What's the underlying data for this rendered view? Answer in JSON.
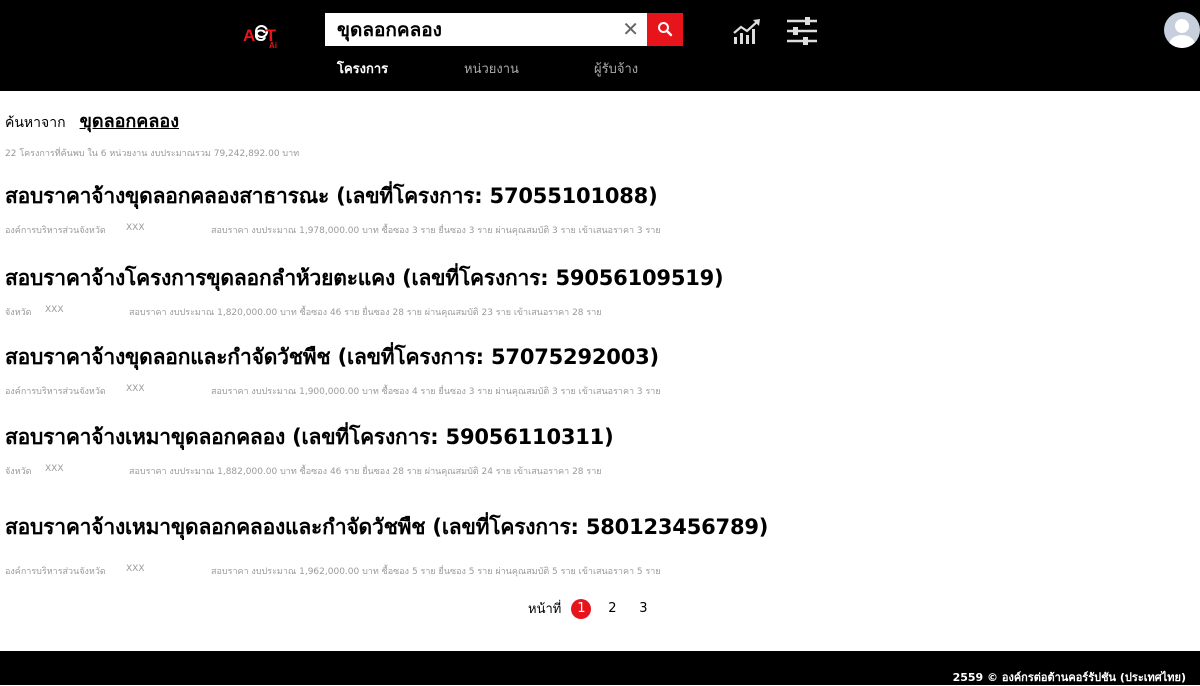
{
  "header": {
    "logo_main": "ACT",
    "logo_sub": "Ai",
    "search_value": "ขุดลอกคลอง",
    "clear_symbol": "✕",
    "tabs": [
      {
        "label": "โครงการ",
        "active": true
      },
      {
        "label": "หน่วยงาน",
        "active": false
      },
      {
        "label": "ผู้รับจ้าง",
        "active": false
      }
    ]
  },
  "main": {
    "search_from_label": "ค้นหาจาก",
    "search_term": "ขุดลอกคลอง",
    "summary": "22 โครงการที่ค้นพบ ใน 6 หน่วยงาน งบประมาณรวม 79,242,892.00 บาท",
    "results": [
      {
        "title": "สอบราคาจ้างขุดลอกคลองสาธารณะ (เลขที่โครงการ: 57055101088)",
        "agency": "องค์การบริหารส่วนจังหวัด",
        "code": "XXX",
        "details": "สอบราคา งบประมาณ 1,978,000.00 บาท ซื้อซอง 3 ราย ยื่นซอง 3 ราย ผ่านคุณสมบัติ 3 ราย เข้าเสนอราคา 3 ราย"
      },
      {
        "title": "สอบราคาจ้างโครงการขุดลอกลำห้วยตะแคง (เลขที่โครงการ: 59056109519)",
        "agency": "จังหวัด",
        "code": "XXX",
        "details": "สอบราคา งบประมาณ 1,820,000.00 บาท ซื้อซอง 46 ราย ยื่นซอง 28 ราย ผ่านคุณสมบัติ 23 ราย เข้าเสนอราคา 28 ราย"
      },
      {
        "title": "สอบราคาจ้างขุดลอกและกำจัดวัชพืช (เลขที่โครงการ: 57075292003)",
        "agency": "องค์การบริหารส่วนจังหวัด",
        "code": "XXX",
        "details": "สอบราคา งบประมาณ 1,900,000.00 บาท ซื้อซอง 4 ราย ยื่นซอง 3 ราย ผ่านคุณสมบัติ 3 ราย เข้าเสนอราคา 3 ราย"
      },
      {
        "title": "สอบราคาจ้างเหมาขุดลอกคลอง (เลขที่โครงการ: 59056110311)",
        "agency": "จังหวัด",
        "code": "XXX",
        "details": "สอบราคา งบประมาณ 1,882,000.00 บาท ซื้อซอง 46 ราย ยื่นซอง 28 ราย ผ่านคุณสมบัติ 24 ราย เข้าเสนอราคา 28 ราย"
      },
      {
        "title": "สอบราคาจ้างเหมาขุดลอกคลองและกำจัดวัชพืช (เลขที่โครงการ: 580123456789)",
        "agency": "องค์การบริหารส่วนจังหวัด",
        "code": "XXX",
        "details": "สอบราคา งบประมาณ 1,962,000.00 บาท ซื้อซอง 5 ราย ยื่นซอง 5 ราย ผ่านคุณสมบัติ 5 ราย เข้าเสนอราคา 5 ราย"
      }
    ],
    "pagination": {
      "label": "หน้าที่",
      "pages": [
        "1",
        "2",
        "3"
      ],
      "current": "1"
    }
  },
  "footer": {
    "text": "2559 © องค์กรต่อต้านคอร์รัปชัน (ประเทศไทย)"
  },
  "colors": {
    "accent": "#e8141c",
    "header_bg": "#000000",
    "meta_text": "#9a9a9a"
  },
  "icons": {
    "search": "search-icon",
    "clear": "close-icon",
    "chart": "trend-chart-icon",
    "filter": "sliders-icon",
    "avatar": "user-avatar-icon"
  }
}
